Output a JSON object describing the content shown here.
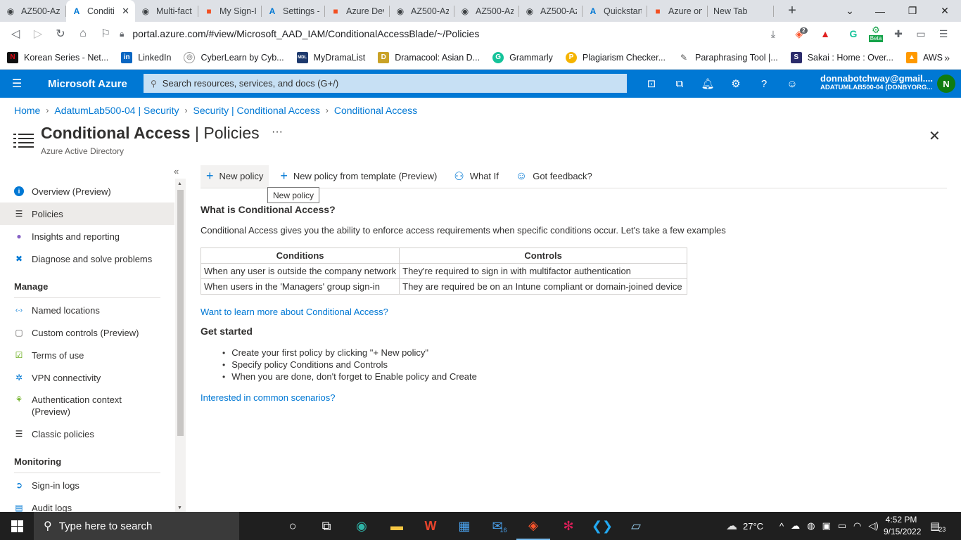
{
  "browser": {
    "tabs": [
      {
        "label": "AZ500-Az",
        "icon": "github-icon"
      },
      {
        "label": "Conditi",
        "icon": "azure-icon",
        "active": true
      },
      {
        "label": "Multi-fact",
        "icon": "github-icon"
      },
      {
        "label": "My Sign-I",
        "icon": "microsoft-icon"
      },
      {
        "label": "Settings -",
        "icon": "azure-icon"
      },
      {
        "label": "Azure Dev",
        "icon": "microsoft-icon"
      },
      {
        "label": "AZ500-Az",
        "icon": "github-icon"
      },
      {
        "label": "AZ500-Az",
        "icon": "github-icon"
      },
      {
        "label": "AZ500-Az",
        "icon": "github-icon"
      },
      {
        "label": "Quickstart",
        "icon": "azure-icon"
      },
      {
        "label": "Azure on",
        "icon": "microsoft-icon"
      },
      {
        "label": "New Tab",
        "icon": ""
      }
    ],
    "new_tab_symbol": "+",
    "url": "portal.azure.com/#view/Microsoft_AAD_IAM/ConditionalAccessBlade/~/Policies",
    "brave_badge": "2",
    "ext_beta": "Beta",
    "bookmarks": [
      {
        "label": "Korean Series - Net...",
        "color": "#111111",
        "glyph": "N"
      },
      {
        "label": "LinkedIn",
        "color": "#0a66c2",
        "glyph": "in"
      },
      {
        "label": "CyberLearn by Cyb...",
        "color": "#555555",
        "glyph": "◎"
      },
      {
        "label": "MyDramaList",
        "color": "#1e3a6e",
        "glyph": "MDL"
      },
      {
        "label": "Dramacool: Asian D...",
        "color": "#c9a227",
        "glyph": "D"
      },
      {
        "label": "Grammarly",
        "color": "#15c39a",
        "glyph": "G"
      },
      {
        "label": "Plagiarism Checker...",
        "color": "#f5b400",
        "glyph": "P"
      },
      {
        "label": "Paraphrasing Tool |...",
        "color": "#777777",
        "glyph": "✎"
      },
      {
        "label": "Sakai : Home : Over...",
        "color": "#2b2b6b",
        "glyph": "S"
      },
      {
        "label": "AWS",
        "color": "#ff9900",
        "glyph": "▲"
      }
    ],
    "bookmarks_more": "»"
  },
  "azure": {
    "brand": "Microsoft Azure",
    "search_placeholder": "Search resources, services, and docs (G+/)",
    "account_email": "donnabotchway@gmail....",
    "account_tenant": "ADATUMLAB500-04 (DONBYORG...",
    "avatar_initial": "N",
    "header_color": "#0078d4"
  },
  "breadcrumb": [
    "Home",
    "AdatumLab500-04 | Security",
    "Security | Conditional Access",
    "Conditional Access"
  ],
  "page": {
    "title_bold": "Conditional Access",
    "title_sep": " | ",
    "title_light": "Policies",
    "more": "···",
    "subtitle": "Azure Active Directory",
    "close": "✕"
  },
  "nav": {
    "collapse": "«",
    "items": [
      {
        "label": "Overview (Preview)",
        "icon": "info-icon"
      },
      {
        "label": "Policies",
        "icon": "list-icon",
        "selected": true
      },
      {
        "label": "Insights and reporting",
        "icon": "lightbulb-icon"
      },
      {
        "label": "Diagnose and solve problems",
        "icon": "wrench-icon"
      }
    ],
    "manage_heading": "Manage",
    "manage_items": [
      {
        "label": "Named locations",
        "icon": "code-icon"
      },
      {
        "label": "Custom controls (Preview)",
        "icon": "document-icon"
      },
      {
        "label": "Terms of use",
        "icon": "check-icon"
      },
      {
        "label": "VPN connectivity",
        "icon": "gear-icon"
      },
      {
        "label": "Authentication context",
        "label2": "(Preview)",
        "icon": "tree-icon"
      },
      {
        "label": "Classic policies",
        "icon": "list-icon"
      }
    ],
    "monitoring_heading": "Monitoring",
    "monitoring_items": [
      {
        "label": "Sign-in logs",
        "icon": "signin-icon"
      },
      {
        "label": "Audit logs",
        "icon": "audit-icon"
      }
    ]
  },
  "toolbar": {
    "new_policy": "New policy",
    "new_from_template": "New policy from template (Preview)",
    "what_if": "What If",
    "feedback": "Got feedback?",
    "tooltip": "New policy"
  },
  "content": {
    "heading": "What is Conditional Access?",
    "intro": "Conditional Access gives you the ability to enforce access requirements when specific conditions occur. Let's take a few examples",
    "table_headers": [
      "Conditions",
      "Controls"
    ],
    "table_rows": [
      [
        "When any user is outside the company network",
        "They're required to sign in with multifactor authentication"
      ],
      [
        "When users in the 'Managers' group sign-in",
        "They are required be on an Intune compliant or domain-joined device"
      ]
    ],
    "learn_more": "Want to learn more about Conditional Access?",
    "get_started": "Get started",
    "steps": [
      "Create your first policy by clicking \"+ New policy\"",
      "Specify policy Conditions and Controls",
      "When you are done, don't forget to Enable policy and Create"
    ],
    "scenarios": "Interested in common scenarios?"
  },
  "taskbar": {
    "search_placeholder": "Type here to search",
    "weather": "27°C",
    "time": "4:52 PM",
    "date": "9/15/2022",
    "mail_badge": "16",
    "notif_count": "23"
  }
}
